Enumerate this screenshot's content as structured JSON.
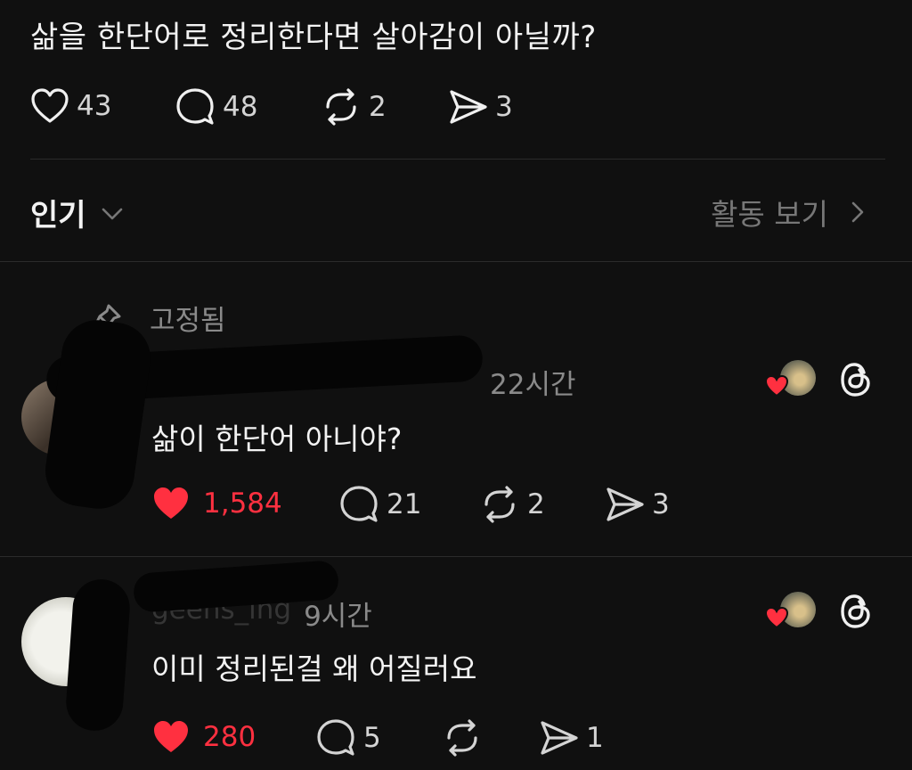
{
  "post": {
    "text": "삶을 한단어로 정리한다면 살아감이 아닐까?",
    "likes": "43",
    "replies": "48",
    "reposts": "2",
    "shares": "3"
  },
  "sort": {
    "label": "인기",
    "activity_label": "활동 보기"
  },
  "pinned_label": "고정됨",
  "comments": [
    {
      "username": "",
      "time": "22시간",
      "text": "삶이 한단어 아니야?",
      "likes": "1,584",
      "replies": "21",
      "reposts": "2",
      "shares": "3"
    },
    {
      "username": "geens_ing",
      "time": "9시간",
      "text": "이미 정리된걸 왜 어질러요",
      "likes": "280",
      "replies": "5",
      "reposts": "",
      "shares": "1"
    }
  ],
  "colors": {
    "background": "#101010",
    "like_red": "#ff3040",
    "muted_text": "#8a8a8a"
  },
  "icons": [
    "heart-icon",
    "comment-icon",
    "repost-icon",
    "share-icon",
    "chevron-down-icon",
    "chevron-right-icon",
    "pin-icon",
    "threads-logo-icon"
  ]
}
